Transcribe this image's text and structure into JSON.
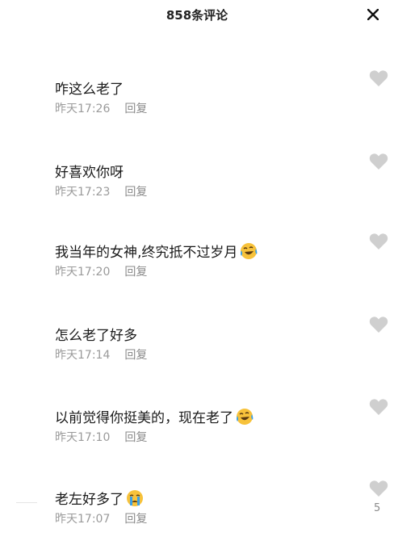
{
  "header": {
    "title": "858条评论",
    "close_icon": "close-icon"
  },
  "comments": [
    {
      "text": "咋这么老了",
      "time": "昨天17:26",
      "reply": "回复",
      "emoji": null,
      "likes": null
    },
    {
      "text": "好喜欢你呀",
      "time": "昨天17:23",
      "reply": "回复",
      "emoji": null,
      "likes": null
    },
    {
      "text": "我当年的女神,终究抵不过岁月",
      "time": "昨天17:20",
      "reply": "回复",
      "emoji": "laughing-crying-emoji",
      "likes": null
    },
    {
      "text": "怎么老了好多",
      "time": "昨天17:14",
      "reply": "回复",
      "emoji": null,
      "likes": null
    },
    {
      "text": "以前觉得你挺美的，现在老了",
      "time": "昨天17:10",
      "reply": "回复",
      "emoji": "laughing-crying-emoji",
      "likes": null
    },
    {
      "text": "老左好多了",
      "time": "昨天17:07",
      "reply": "回复",
      "emoji": "crying-emoji",
      "likes": "5"
    }
  ],
  "colors": {
    "text": "#1a1a1a",
    "meta": "#9a9a9a",
    "heart": "#cfcfcf",
    "emoji_face": "#f7c23b",
    "tear": "#3aa0e8"
  }
}
